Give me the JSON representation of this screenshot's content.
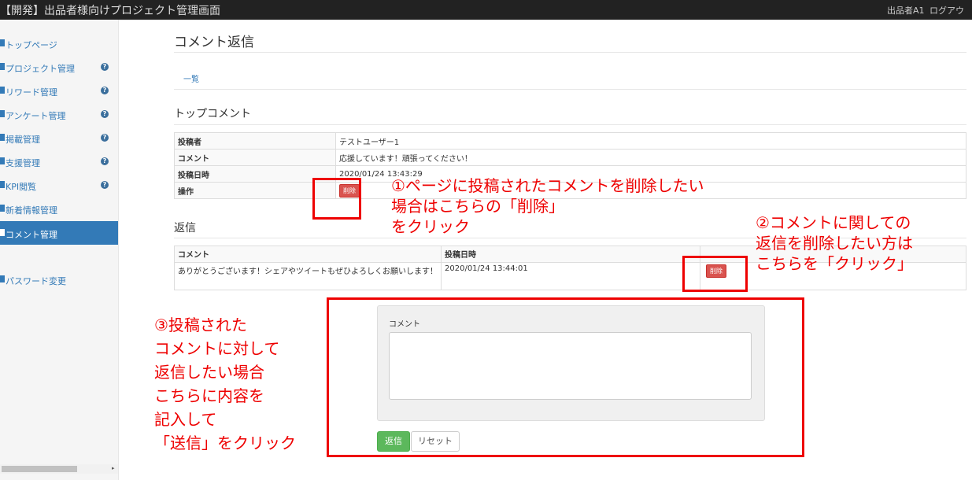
{
  "header": {
    "title": "【開発】出品者様向けプロジェクト管理画面",
    "user": "出品者A1",
    "logout": "ログアウ"
  },
  "sidebar": {
    "items": [
      {
        "label": "トップページ",
        "icon": "home-icon",
        "help": false
      },
      {
        "label": "プロジェクト管理",
        "icon": "wrench-icon",
        "help": true
      },
      {
        "label": "リワード管理",
        "icon": "gift-icon",
        "help": true
      },
      {
        "label": "アンケート管理",
        "icon": "list-icon",
        "help": true
      },
      {
        "label": "掲載管理",
        "icon": "book-icon",
        "help": true
      },
      {
        "label": "支援管理",
        "icon": "list-icon",
        "help": true
      },
      {
        "label": "KPI閲覧",
        "icon": "chart-icon",
        "help": true
      },
      {
        "label": "新着情報管理",
        "icon": "bullhorn-icon",
        "help": false
      },
      {
        "label": "コメント管理",
        "icon": "comment-icon",
        "help": false,
        "active": true
      },
      {
        "label": "パスワード変更",
        "icon": "wrench-icon",
        "help": false
      }
    ]
  },
  "main": {
    "title": "コメント返信",
    "tab": "一覧",
    "top_comment": {
      "heading": "トップコメント",
      "rows": [
        {
          "label": "投稿者",
          "value": "テストユーザー1"
        },
        {
          "label": "コメント",
          "value": "応援しています！頑張ってください！"
        },
        {
          "label": "投稿日時",
          "value": "2020/01/24 13:43:29"
        },
        {
          "label": "操作",
          "value": ""
        }
      ],
      "delete_label": "削除"
    },
    "replies": {
      "heading": "返信",
      "columns": [
        "コメント",
        "投稿日時",
        ""
      ],
      "rows": [
        {
          "comment": "ありがとうございます！シェアやツイートもぜひよろしくお願いします！",
          "date": "2020/01/24 13:44:01",
          "delete_label": "削除"
        }
      ]
    },
    "form": {
      "label": "コメント",
      "textarea_value": "",
      "send": "返信",
      "reset": "リセット"
    }
  },
  "annotations": {
    "a1": "①ページに投稿されたコメントを削除したい\n場合はこちらの「削除」\nをクリック",
    "a2": "②コメントに関しての\n返信を削除したい方は\nこちらを「クリック」",
    "a3": "③投稿された\nコメントに対して\n返信したい場合\nこちらに内容を\n記入して\n「送信」をクリック"
  },
  "colors": {
    "accent": "#337ab7",
    "danger": "#d9534f",
    "success": "#5cb85c",
    "annotation": "#e00000"
  }
}
